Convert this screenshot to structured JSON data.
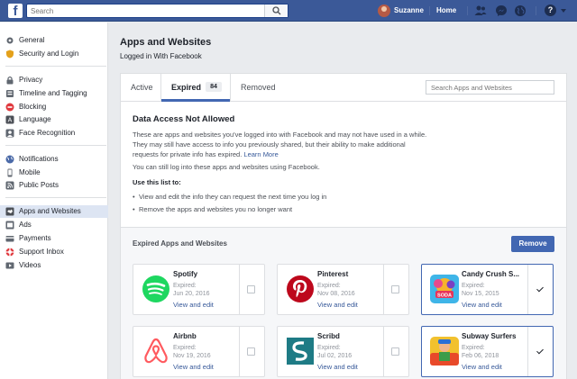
{
  "topbar": {
    "search_placeholder": "Search",
    "user_name": "Suzanne",
    "home_label": "Home",
    "colors": {
      "bar": "#3b5998"
    }
  },
  "sidebar": {
    "groups": [
      [
        {
          "label": "General",
          "icon": "gear-icon"
        },
        {
          "label": "Security and Login",
          "icon": "shield-icon"
        }
      ],
      [
        {
          "label": "Privacy",
          "icon": "lock-icon"
        },
        {
          "label": "Timeline and Tagging",
          "icon": "timeline-icon"
        },
        {
          "label": "Blocking",
          "icon": "block-icon"
        },
        {
          "label": "Language",
          "icon": "language-icon"
        },
        {
          "label": "Face Recognition",
          "icon": "face-icon"
        }
      ],
      [
        {
          "label": "Notifications",
          "icon": "globe-icon"
        },
        {
          "label": "Mobile",
          "icon": "mobile-icon"
        },
        {
          "label": "Public Posts",
          "icon": "rss-icon"
        }
      ],
      [
        {
          "label": "Apps and Websites",
          "icon": "apps-icon",
          "active": true
        },
        {
          "label": "Ads",
          "icon": "ads-icon"
        },
        {
          "label": "Payments",
          "icon": "card-icon"
        },
        {
          "label": "Support Inbox",
          "icon": "lifebuoy-icon"
        },
        {
          "label": "Videos",
          "icon": "video-icon"
        }
      ]
    ]
  },
  "main": {
    "title": "Apps and Websites",
    "subtitle": "Logged in With Facebook",
    "tabs": {
      "active": "Active",
      "expired": "Expired",
      "expired_count": "84",
      "removed": "Removed"
    },
    "search_placeholder": "Search Apps and Websites",
    "notice": {
      "title": "Data Access Not Allowed",
      "body": "These are apps and websites you've logged into with Facebook and may not have used in a while. They may still have access to info you previously shared, but their ability to make additional requests for private info has expired.",
      "learn_more": "Learn More",
      "line2": "You can still log into these apps and websites using Facebook.",
      "use_title": "Use this list to:",
      "bullets": [
        "View and edit the info they can request the next time you log in",
        "Remove the apps and websites you no longer want"
      ]
    },
    "expired_section": {
      "title": "Expired Apps and Websites",
      "remove_label": "Remove",
      "cards": [
        {
          "name": "Spotify",
          "expired_label": "Expired:",
          "date": "Jun 20, 2016",
          "link": "View and edit",
          "checked": false,
          "icon": "spotify-logo"
        },
        {
          "name": "Pinterest",
          "expired_label": "Expired:",
          "date": "Nov 08, 2016",
          "link": "View and edit",
          "checked": false,
          "icon": "pinterest-logo"
        },
        {
          "name": "Candy Crush S...",
          "expired_label": "Expired:",
          "date": "Nov 15, 2015",
          "link": "View and edit",
          "checked": true,
          "icon": "candy-crush-logo"
        },
        {
          "name": "Airbnb",
          "expired_label": "Expired:",
          "date": "Nov 19, 2016",
          "link": "View and edit",
          "checked": false,
          "icon": "airbnb-logo"
        },
        {
          "name": "Scribd",
          "expired_label": "Expired:",
          "date": "Jul 02, 2016",
          "link": "View and edit",
          "checked": false,
          "icon": "scribd-logo"
        },
        {
          "name": "Subway Surfers",
          "expired_label": "Expired:",
          "date": "Feb 06, 2018",
          "link": "View and edit",
          "checked": true,
          "icon": "subway-surfers-logo"
        }
      ]
    }
  }
}
